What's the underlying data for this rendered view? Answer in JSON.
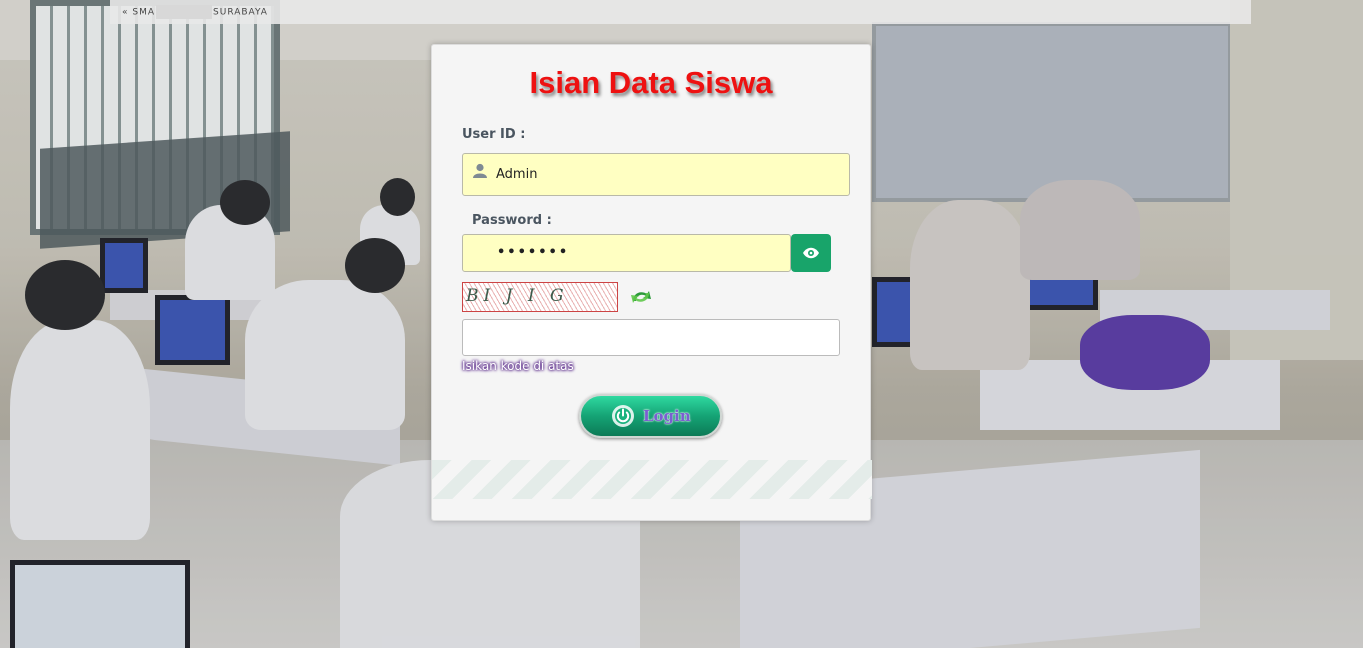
{
  "topbar": {
    "prefix": "« SMA",
    "suffix": "SURABAYA"
  },
  "login": {
    "title": "Isian Data Siswa",
    "user_label": "User ID :",
    "user_value": "Admin",
    "password_label": "Password :",
    "password_value": "•••••••",
    "captcha_text": "BI J I G",
    "captcha_hint": "Isikan kode di atas",
    "login_label": "Login"
  },
  "icons": {
    "user": "user-icon",
    "eye": "eye-icon",
    "refresh": "refresh-icon",
    "power": "power-icon"
  },
  "colors": {
    "title": "#ee1111",
    "field_bg": "#ffffc2",
    "accent_green": "#18a46a"
  }
}
